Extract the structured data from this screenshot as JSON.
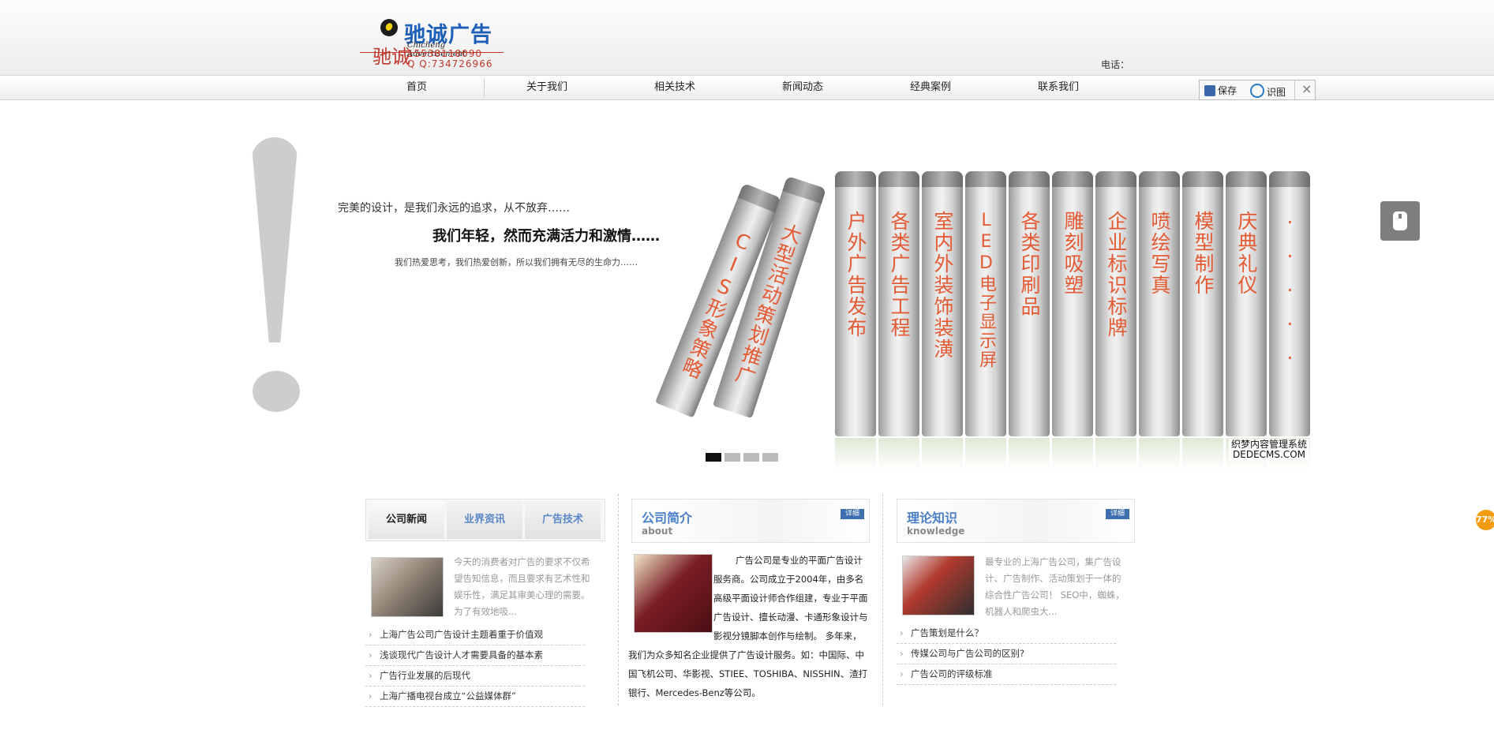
{
  "header": {
    "logo_title": "驰诚广告",
    "logo_seal": "驰诚",
    "logo_subtitle": "Chicheng Advertisement",
    "logo_phone": "15538118090",
    "logo_qq": "Q Q:734726966",
    "phone_label": "电话："
  },
  "nav": {
    "items": [
      "首页",
      "关于我们",
      "相关技术",
      "新闻动态",
      "经典案例",
      "联系我们"
    ]
  },
  "toolbar": {
    "save": "保存",
    "view": "识图",
    "close": "×"
  },
  "banner": {
    "slogan1": "完美的设计，是我们永远的追求，从不放弃……",
    "slogan2": "我们年轻，然而充满活力和激情……",
    "slogan3": "我们热爱思考，我们热爱创新，所以我们拥有无尽的生命力……",
    "books": [
      "CIS形象策略",
      "大型活动策划推广",
      "户外广告发布",
      "各类广告工程",
      "室内外装饰装潢",
      "LED电子显示屏",
      "各类印刷品",
      "雕刻吸塑",
      "企业标识标牌",
      "喷绘写真",
      "模型制作",
      "庆典礼仪",
      "·····"
    ],
    "watermark_line1": "织梦内容管理系统",
    "watermark_line2": "DEDECMS.COM",
    "slide_count": 4,
    "active_slide": 1
  },
  "side": {
    "badge": "77%"
  },
  "news": {
    "tabs": [
      "公司新闻",
      "业界资讯",
      "广告技术"
    ],
    "active_tab": 0,
    "summary": "今天的消费者对广告的要求不仅希望告知信息，而且要求有艺术性和娱乐性，满足其审美心理的需要。为了有效地吸...",
    "items": [
      "上海广告公司广告设计主题着重于价值观",
      "浅谈现代广告设计人才需要具备的基本素",
      "广告行业发展的后现代",
      "上海广播电视台成立“公益媒体群”"
    ]
  },
  "about": {
    "title": "公司简介",
    "en": "about",
    "more": "详细",
    "text": "广告公司是专业的平面广告设计服务商。公司成立于2004年，由多名高级平面设计师合作组建，专业于平面广告设计、擅长动漫、卡通形象设计与影视分镜脚本创作与绘制。 多年来，我们为众多知名企业提供了广告设计服务。如：中国际、中国飞机公司、华影视、STIEE、TOSHIBA、NISSHIN、渣打银行、Mercedes-Benz等公司。"
  },
  "knowledge": {
    "title": "理论知识",
    "en": "knowledge",
    "more": "详细",
    "summary": "最专业的上海广告公司，集广告设计、广告制作、活动策划于一体的综合性广告公司！ SEO中，蜘蛛，机器人和爬虫大...",
    "items": [
      "广告策划是什么？",
      "传媒公司与广告公司的区别?",
      "广告公司的评级标准"
    ]
  }
}
